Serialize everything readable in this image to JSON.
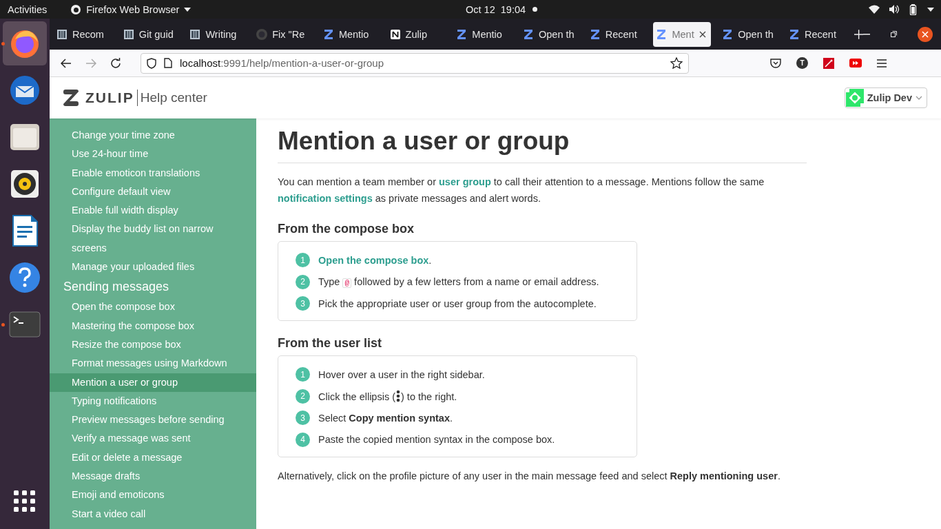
{
  "topbar": {
    "activities": "Activities",
    "app_menu": "Firefox Web Browser",
    "clock": "Oct 12  19:04"
  },
  "dock": [
    {
      "kind": "firefox",
      "running": true,
      "selected": true
    },
    {
      "kind": "mail",
      "running": false,
      "selected": false
    },
    {
      "kind": "files",
      "running": false,
      "selected": false
    },
    {
      "kind": "music",
      "running": false,
      "selected": false
    },
    {
      "kind": "writer",
      "running": false,
      "selected": false
    },
    {
      "kind": "help",
      "running": false,
      "selected": false
    },
    {
      "kind": "terminal",
      "running": true,
      "selected": false
    },
    {
      "kind": "apps",
      "running": false,
      "selected": false
    }
  ],
  "tabs": [
    {
      "title": "Recom",
      "kind": "doc",
      "selected": false
    },
    {
      "title": "Git guid",
      "kind": "doc",
      "selected": false
    },
    {
      "title": "Writing",
      "kind": "doc",
      "selected": false
    },
    {
      "title": "Fix \"Re",
      "kind": "github",
      "selected": false
    },
    {
      "title": "Mentio",
      "kind": "zulip",
      "selected": false
    },
    {
      "title": "Zulip",
      "kind": "notion",
      "selected": false
    },
    {
      "title": "Mentio",
      "kind": "zulip",
      "selected": false
    },
    {
      "title": "Open th",
      "kind": "zulip",
      "selected": false
    },
    {
      "title": "Recent",
      "kind": "zulip",
      "selected": false
    },
    {
      "title": "Ment",
      "kind": "zulip",
      "selected": true
    },
    {
      "title": "Open th",
      "kind": "zulip",
      "selected": false
    },
    {
      "title": "Recent",
      "kind": "zulip",
      "selected": false
    }
  ],
  "address_bar": {
    "host": "localhost",
    "path": ":9991/help/mention-a-user-or-group"
  },
  "toolbar": {
    "account_initial": "T"
  },
  "header": {
    "logo": "ZULIP",
    "title": "Help center",
    "org": "Zulip Dev"
  },
  "sidebar": {
    "items": [
      {
        "label": "Change your time zone",
        "selected": false
      },
      {
        "label": "Use 24-hour time",
        "selected": false
      },
      {
        "label": "Enable emoticon translations",
        "selected": false
      },
      {
        "label": "Configure default view",
        "selected": false
      },
      {
        "label": "Enable full width display",
        "selected": false
      },
      {
        "label": "Display the buddy list on narrow screens",
        "selected": false
      },
      {
        "label": "Manage your uploaded files",
        "selected": false
      }
    ],
    "sections": [
      {
        "title": "Sending messages",
        "items": [
          {
            "label": "Open the compose box",
            "selected": false
          },
          {
            "label": "Mastering the compose box",
            "selected": false
          },
          {
            "label": "Resize the compose box",
            "selected": false
          },
          {
            "label": "Format messages using Markdown",
            "selected": false
          },
          {
            "label": "Mention a user or group",
            "selected": true
          },
          {
            "label": "Typing notifications",
            "selected": false
          },
          {
            "label": "Preview messages before sending",
            "selected": false
          },
          {
            "label": "Verify a message was sent",
            "selected": false
          },
          {
            "label": "Edit or delete a message",
            "selected": false
          },
          {
            "label": "Message drafts",
            "selected": false
          },
          {
            "label": "Emoji and emoticons",
            "selected": false
          },
          {
            "label": "Start a video call",
            "selected": false
          }
        ]
      }
    ]
  },
  "article": {
    "title": "Mention a user or group",
    "intro": [
      {
        "kind": "text",
        "text": "You can mention a team member or "
      },
      {
        "kind": "link",
        "text": "user group"
      },
      {
        "kind": "text",
        "text": " to call their attention to a message. Mentions follow the same "
      },
      {
        "kind": "link",
        "text": "notification settings"
      },
      {
        "kind": "text",
        "text": " as private messages and alert words."
      }
    ],
    "sections": [
      {
        "title": "From the compose box",
        "steps": [
          {
            "number": "1",
            "parts": [
              {
                "kind": "link",
                "text": "Open the compose box"
              },
              {
                "kind": "text",
                "text": "."
              }
            ]
          },
          {
            "number": "2",
            "parts": [
              {
                "kind": "text",
                "text": "Type "
              },
              {
                "kind": "code",
                "text": "@"
              },
              {
                "kind": "text",
                "text": " followed by a few letters from a name or email address."
              }
            ]
          },
          {
            "number": "3",
            "parts": [
              {
                "kind": "text",
                "text": "Pick the appropriate user or user group from the autocomplete."
              }
            ]
          }
        ]
      },
      {
        "title": "From the user list",
        "steps": [
          {
            "number": "1",
            "parts": [
              {
                "kind": "text",
                "text": "Hover over a user in the right sidebar."
              }
            ]
          },
          {
            "number": "2",
            "parts": [
              {
                "kind": "text",
                "text": "Click the ellipsis ("
              },
              {
                "kind": "ellipsis"
              },
              {
                "kind": "text",
                "text": ") to the right."
              }
            ]
          },
          {
            "number": "3",
            "parts": [
              {
                "kind": "text",
                "text": "Select "
              },
              {
                "kind": "bold",
                "text": "Copy mention syntax"
              },
              {
                "kind": "text",
                "text": "."
              }
            ]
          },
          {
            "number": "4",
            "parts": [
              {
                "kind": "text",
                "text": "Paste the copied mention syntax in the compose box."
              }
            ]
          }
        ]
      }
    ],
    "outro": [
      {
        "kind": "text",
        "text": "Alternatively, click on the profile picture of any user in the main message feed and select "
      },
      {
        "kind": "bold",
        "text": "Reply mentioning user"
      },
      {
        "kind": "text",
        "text": "."
      }
    ]
  }
}
